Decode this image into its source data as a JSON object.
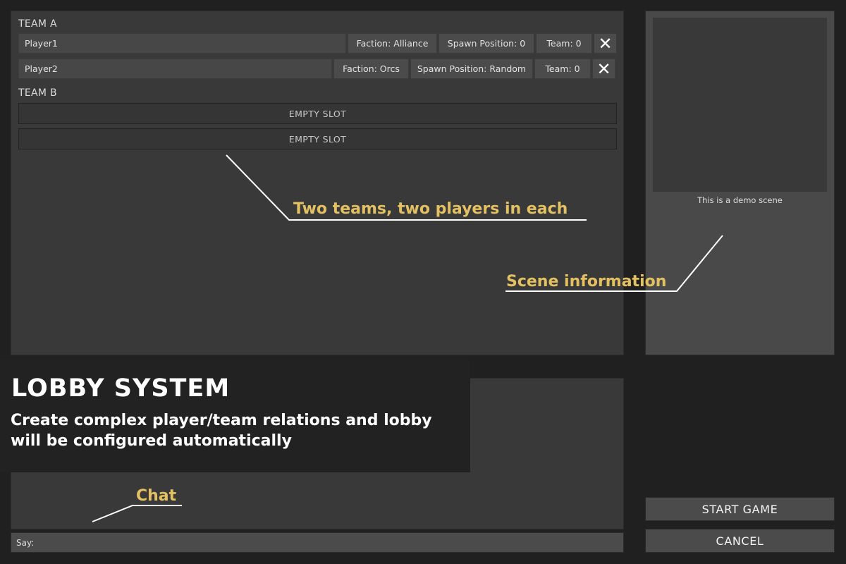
{
  "team_a": {
    "label": "TEAM A",
    "players": [
      {
        "name": "Player1",
        "faction": "Faction: Alliance",
        "spawn": "Spawn Position: 0",
        "team": "Team: 0",
        "remove": "✕"
      },
      {
        "name": "Player2",
        "faction": "Faction: Orcs",
        "spawn": "Spawn Position: Random",
        "team": "Team: 0",
        "remove": "✕"
      }
    ]
  },
  "team_b": {
    "label": "TEAM B",
    "slots": [
      "EMPTY SLOT",
      "EMPTY SLOT"
    ]
  },
  "scene": {
    "caption": "This is a demo scene"
  },
  "chat": {
    "say_label": "Say:",
    "say_value": ""
  },
  "buttons": {
    "start": "START GAME",
    "cancel": "CANCEL"
  },
  "banner": {
    "title": "LOBBY SYSTEM",
    "subtitle": "Create complex player/team relations and lobby will be configured automatically"
  },
  "annotations": {
    "teams": "Two teams, two players in each",
    "scene": "Scene information",
    "chat": "Chat",
    "color": "#e3c062"
  },
  "colors": {
    "background": "#202020",
    "panel": "#393939",
    "cell": "#4b4b4b"
  }
}
